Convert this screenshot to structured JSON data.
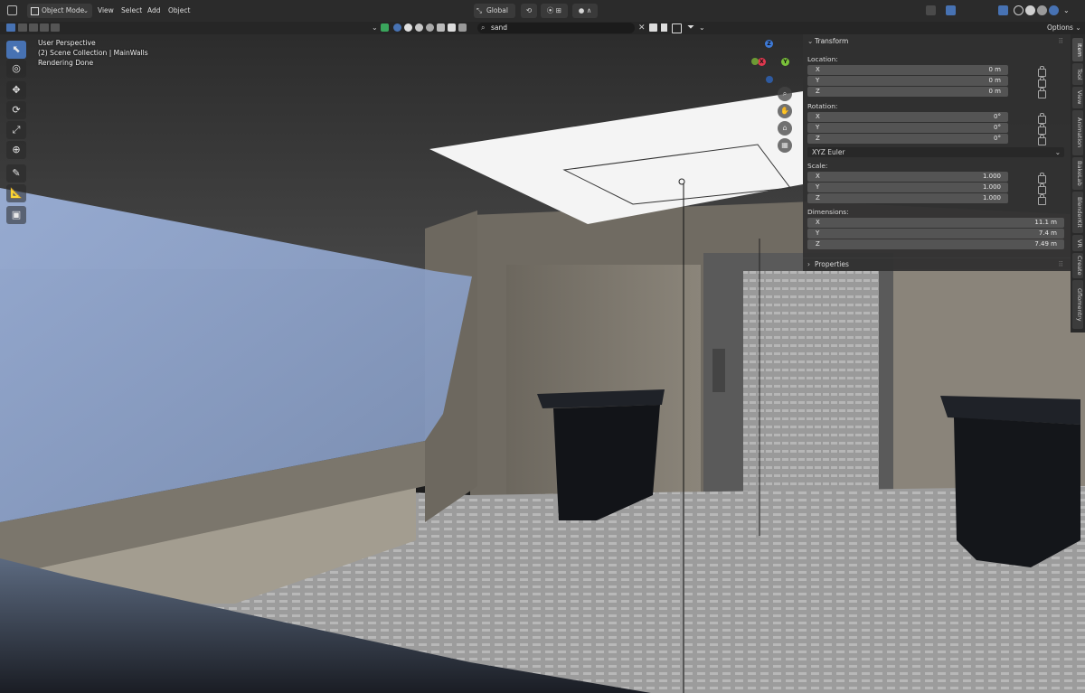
{
  "header": {
    "mode": "Object Mode",
    "menus": [
      "View",
      "Select",
      "Add",
      "Object"
    ],
    "orientation": "Global",
    "search_value": "sand",
    "options_label": "Options"
  },
  "viewport_info": {
    "perspective": "User Perspective",
    "collection": "(2) Scene Collection | MainWalls",
    "status": "Rendering Done"
  },
  "gizmo": {
    "x": "X",
    "y": "Y",
    "z": "Z"
  },
  "npanel": {
    "transform_title": "Transform",
    "location_label": "Location:",
    "location": [
      {
        "axis": "X",
        "value": "0 m"
      },
      {
        "axis": "Y",
        "value": "0 m"
      },
      {
        "axis": "Z",
        "value": "0 m"
      }
    ],
    "rotation_label": "Rotation:",
    "rotation": [
      {
        "axis": "X",
        "value": "0°"
      },
      {
        "axis": "Y",
        "value": "0°"
      },
      {
        "axis": "Z",
        "value": "0°"
      }
    ],
    "rotation_mode": "XYZ Euler",
    "scale_label": "Scale:",
    "scale": [
      {
        "axis": "X",
        "value": "1.000"
      },
      {
        "axis": "Y",
        "value": "1.000"
      },
      {
        "axis": "Z",
        "value": "1.000"
      }
    ],
    "dimensions_label": "Dimensions:",
    "dimensions": [
      {
        "axis": "X",
        "value": "11.1 m"
      },
      {
        "axis": "Y",
        "value": "7.4 m"
      },
      {
        "axis": "Z",
        "value": "7.49 m"
      }
    ],
    "properties_title": "Properties"
  },
  "sidebar_tabs": [
    "Item",
    "Tool",
    "View",
    "Animation",
    "BakeLab",
    "BlenderKit",
    "VR",
    "Create",
    "Gflomentry"
  ],
  "colors": {
    "accent": "#4772b3",
    "header": "#2b2b2b",
    "panel": "#303030",
    "field": "#545454"
  }
}
